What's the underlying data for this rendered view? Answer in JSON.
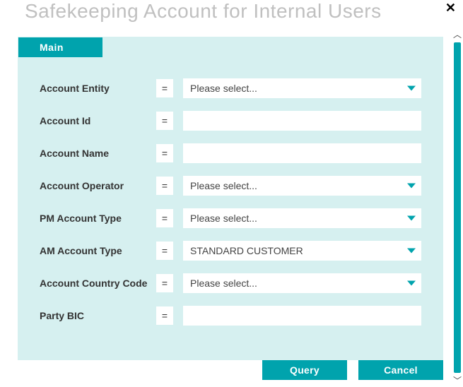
{
  "title": "Safekeeping Account for Internal Users",
  "tab_label": "Main",
  "eq_symbol": "=",
  "fields": [
    {
      "label": "Account Entity",
      "type": "dropdown",
      "value": "Please select..."
    },
    {
      "label": "Account Id",
      "type": "text",
      "value": ""
    },
    {
      "label": "Account Name",
      "type": "text",
      "value": ""
    },
    {
      "label": "Account Operator",
      "type": "dropdown",
      "value": "Please select..."
    },
    {
      "label": "PM Account Type",
      "type": "dropdown",
      "value": "Please select..."
    },
    {
      "label": "AM Account Type",
      "type": "dropdown",
      "value": "STANDARD CUSTOMER"
    },
    {
      "label": "Account Country Code",
      "type": "dropdown",
      "value": "Please select..."
    },
    {
      "label": "Party BIC",
      "type": "text",
      "value": ""
    }
  ],
  "buttons": {
    "query": "Query",
    "cancel": "Cancel"
  }
}
